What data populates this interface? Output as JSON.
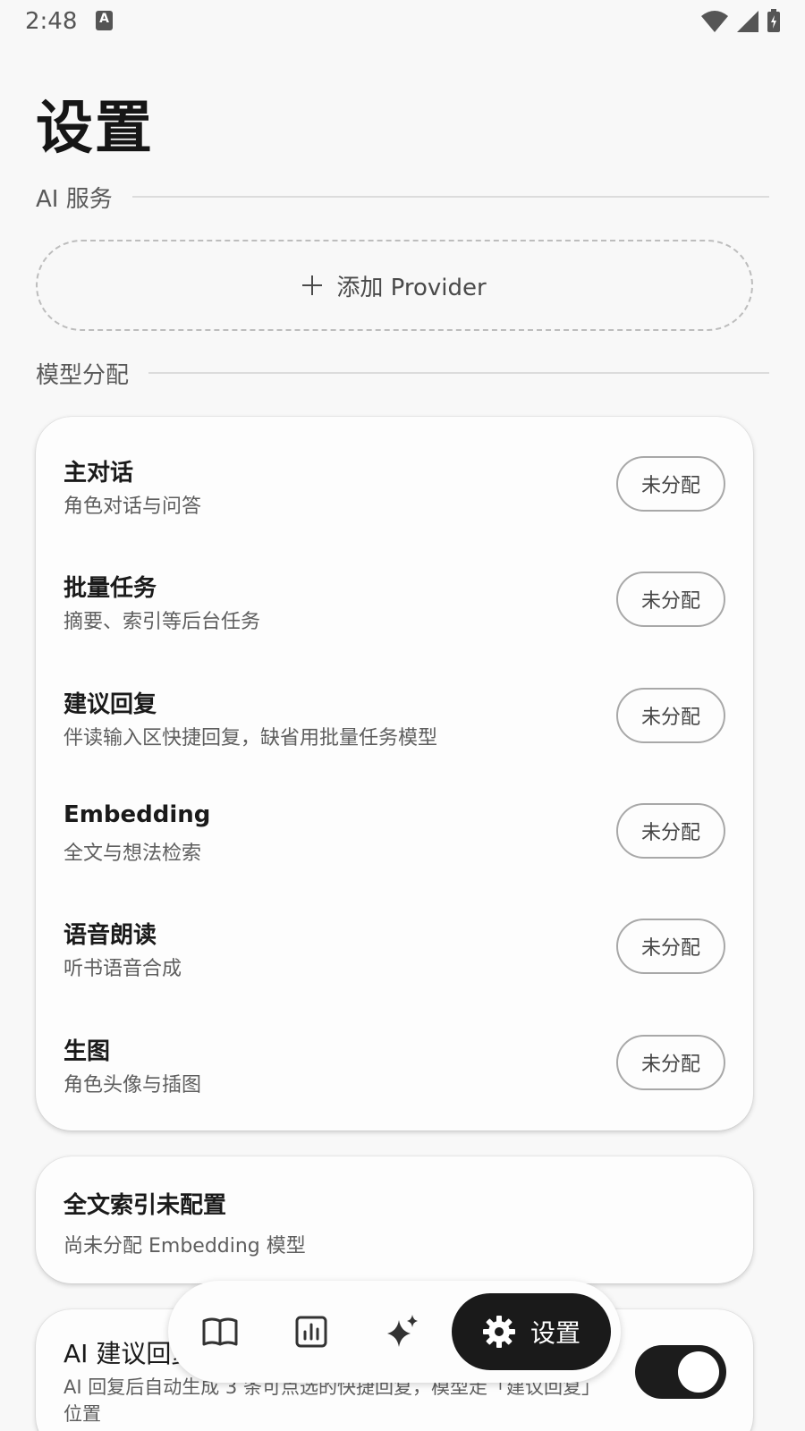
{
  "status_bar": {
    "time": "2:48",
    "notification_icon_letter": "A"
  },
  "page": {
    "title": "设置"
  },
  "sections": {
    "ai_service": "AI 服务",
    "model_assignment": "模型分配"
  },
  "add_provider": {
    "label": "添加 Provider"
  },
  "model_rows": [
    {
      "title": "主对话",
      "subtitle": "角色对话与问答",
      "status": "未分配"
    },
    {
      "title": "批量任务",
      "subtitle": "摘要、索引等后台任务",
      "status": "未分配"
    },
    {
      "title": "建议回复",
      "subtitle": "伴读输入区快捷回复，缺省用批量任务模型",
      "status": "未分配"
    },
    {
      "title": "Embedding",
      "subtitle": "全文与想法检索",
      "status": "未分配"
    },
    {
      "title": "语音朗读",
      "subtitle": "听书语音合成",
      "status": "未分配"
    },
    {
      "title": "生图",
      "subtitle": "角色头像与插图",
      "status": "未分配"
    }
  ],
  "fulltext_index": {
    "title": "全文索引未配置",
    "subtitle": "尚未分配 Embedding 模型"
  },
  "ai_suggest": {
    "title": "AI 建议回复",
    "description": "AI 回复后自动生成 3 条可点选的快捷回复，模型走「建议回复」位置",
    "enabled": true
  },
  "bottom_nav": {
    "items": [
      {
        "icon": "book-icon"
      },
      {
        "icon": "chart-icon"
      },
      {
        "icon": "sparkle-icon"
      }
    ],
    "active": {
      "icon": "gear-icon",
      "label": "设置"
    }
  },
  "colors": {
    "accent": "#1a1a1a",
    "background": "#f8f8f8",
    "card": "#fdfdfd"
  }
}
